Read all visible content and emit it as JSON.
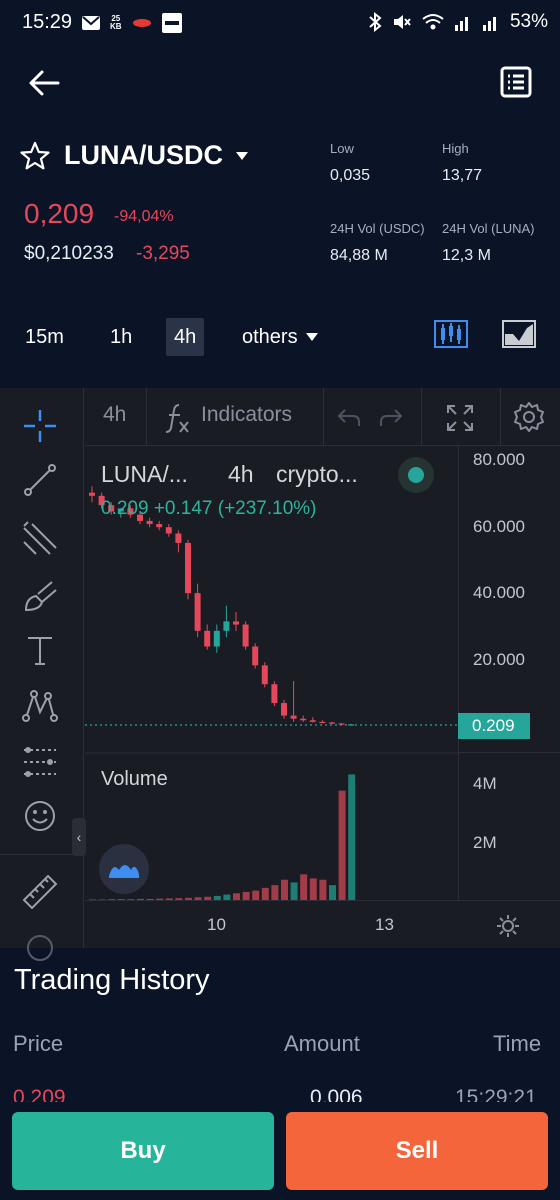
{
  "status_bar": {
    "time": "15:29",
    "data_rate_top": "25",
    "data_rate_bottom": "KB",
    "battery": "53%"
  },
  "header": {
    "pair": "LUNA/USDC",
    "icons": [
      "back-arrow-icon",
      "order-book-icon",
      "star-icon",
      "caret-down-icon"
    ]
  },
  "ticker": {
    "price": "0,209",
    "change_pct": "-94,04%",
    "usd_price": "$0,210233",
    "usd_change": "-3,295",
    "low_label": "Low",
    "low_value": "0,035",
    "high_label": "High",
    "high_value": "13,77",
    "vol_usdc_label": "24H Vol (USDC)",
    "vol_usdc_value": "84,88 M",
    "vol_luna_label": "24H Vol (LUNA)",
    "vol_luna_value": "12,3 M",
    "up_color": "#26a69a",
    "down_color": "#e5485a"
  },
  "timeframes": {
    "items": [
      "15m",
      "1h",
      "4h"
    ],
    "active": "4h",
    "others_label": "others"
  },
  "chart_toolbar": {
    "interval": "4h",
    "indicators_label": "Indicators",
    "fx_label": "f"
  },
  "chart_legend": {
    "symbol": "LUNA/...",
    "interval": "4h",
    "source": "crypto...",
    "values": "0.209 +0.147 (+237.10%)",
    "volume_label": "Volume",
    "last_price_tag": "0.209"
  },
  "chart_data": {
    "type": "candlestick",
    "y_ticks": [
      "80.000",
      "60.000",
      "40.000",
      "20.000"
    ],
    "volume_ticks": [
      "4M",
      "2M"
    ],
    "x_ticks": [
      "10",
      "13"
    ],
    "ylim": [
      0,
      86
    ],
    "last_price": 0.209,
    "candles": [
      {
        "o": 74,
        "h": 76,
        "l": 71,
        "c": 73
      },
      {
        "o": 73,
        "h": 74,
        "l": 69,
        "c": 70
      },
      {
        "o": 70,
        "h": 71,
        "l": 67,
        "c": 68
      },
      {
        "o": 68,
        "h": 69,
        "l": 66,
        "c": 69
      },
      {
        "o": 69,
        "h": 70,
        "l": 66,
        "c": 67
      },
      {
        "o": 67,
        "h": 68,
        "l": 64,
        "c": 65
      },
      {
        "o": 65,
        "h": 66,
        "l": 63,
        "c": 64
      },
      {
        "o": 64,
        "h": 65,
        "l": 62,
        "c": 63
      },
      {
        "o": 63,
        "h": 64,
        "l": 60,
        "c": 61
      },
      {
        "o": 61,
        "h": 62,
        "l": 55,
        "c": 58
      },
      {
        "o": 58,
        "h": 59,
        "l": 40,
        "c": 42
      },
      {
        "o": 42,
        "h": 45,
        "l": 28,
        "c": 30
      },
      {
        "o": 30,
        "h": 32,
        "l": 24,
        "c": 25
      },
      {
        "o": 25,
        "h": 32,
        "l": 23,
        "c": 30
      },
      {
        "o": 30,
        "h": 38,
        "l": 28,
        "c": 33
      },
      {
        "o": 33,
        "h": 36,
        "l": 30,
        "c": 32
      },
      {
        "o": 32,
        "h": 33,
        "l": 24,
        "c": 25
      },
      {
        "o": 25,
        "h": 26,
        "l": 18,
        "c": 19
      },
      {
        "o": 19,
        "h": 20,
        "l": 12,
        "c": 13
      },
      {
        "o": 13,
        "h": 14,
        "l": 6,
        "c": 7
      },
      {
        "o": 7,
        "h": 8,
        "l": 2,
        "c": 3
      },
      {
        "o": 3,
        "h": 14,
        "l": 1,
        "c": 2
      },
      {
        "o": 2,
        "h": 3,
        "l": 1,
        "c": 1.5
      },
      {
        "o": 1.5,
        "h": 2.5,
        "l": 0.8,
        "c": 1
      },
      {
        "o": 1,
        "h": 1.5,
        "l": 0.5,
        "c": 0.8
      },
      {
        "o": 0.8,
        "h": 1,
        "l": 0.3,
        "c": 0.5
      },
      {
        "o": 0.5,
        "h": 0.6,
        "l": 0.1,
        "c": 0.2
      },
      {
        "o": 0.2,
        "h": 0.3,
        "l": 0.05,
        "c": 0.209
      }
    ],
    "volumes": [
      0.02,
      0.02,
      0.03,
      0.03,
      0.03,
      0.04,
      0.04,
      0.05,
      0.06,
      0.07,
      0.08,
      0.1,
      0.12,
      0.15,
      0.2,
      0.25,
      0.3,
      0.35,
      0.45,
      0.55,
      0.75,
      0.65,
      0.95,
      0.8,
      0.75,
      0.55,
      4.05,
      4.65
    ],
    "volume_up": [
      false,
      false,
      false,
      true,
      false,
      false,
      false,
      false,
      false,
      false,
      false,
      false,
      false,
      true,
      true,
      false,
      false,
      false,
      false,
      false,
      false,
      true,
      false,
      false,
      false,
      true,
      false,
      true
    ],
    "volume_max": 5
  },
  "trading_history": {
    "title": "Trading History",
    "col_price": "Price",
    "col_amount": "Amount",
    "col_time": "Time",
    "rows": [
      {
        "price": "0,209",
        "amount": "0,006",
        "time": "15:29:21"
      }
    ]
  },
  "actions": {
    "buy": "Buy",
    "sell": "Sell"
  }
}
